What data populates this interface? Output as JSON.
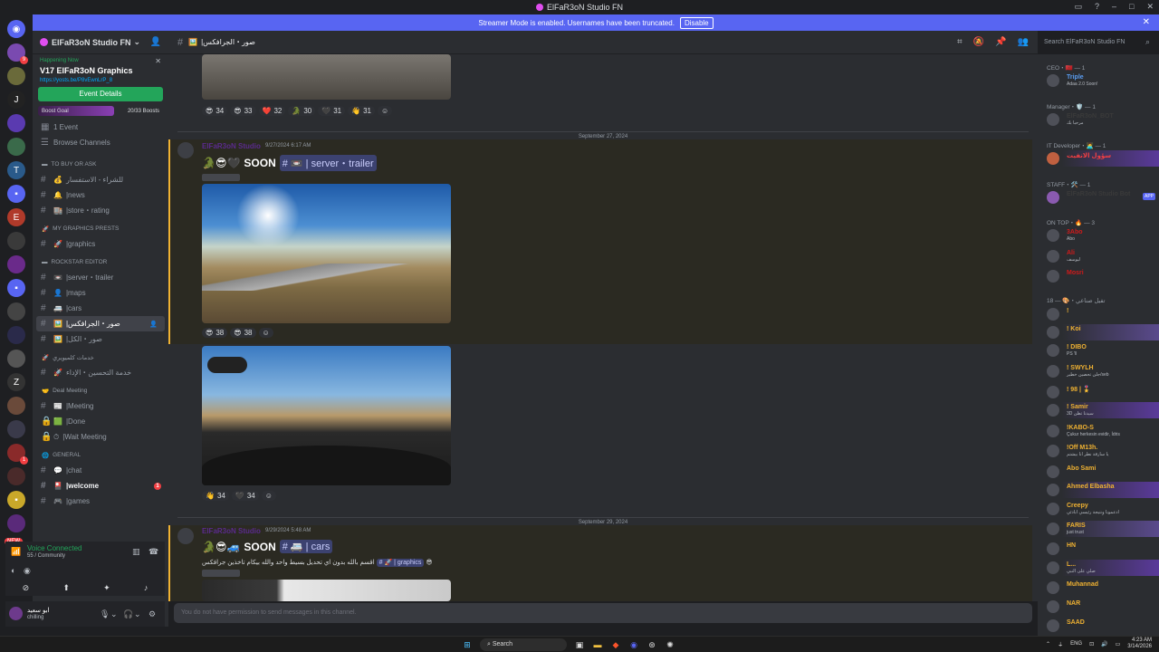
{
  "window": {
    "title": "ElFaR3oN Studio FN"
  },
  "banner": {
    "text": "Streamer Mode is enabled. Usernames have been truncated.",
    "button": "Disable"
  },
  "guild": {
    "name": "ElFaR3oN Studio FN"
  },
  "event": {
    "status": "Happening Now",
    "name": "V17 ElFaR3oN Graphics",
    "link": "https://yosts.be/P8vEwnLrP_8",
    "button": "Event Details"
  },
  "boost": {
    "label": "Boost Goal",
    "progress": "20/33 Boosts",
    "fraction": 0.606
  },
  "sidebar": {
    "events": "1 Event",
    "browse": "Browse Channels",
    "cat1": "TO BUY OR ASK",
    "ch_buy": "للشراء - الاستفسار",
    "ch_news": "news",
    "ch_store": "store・rating",
    "cat2": "MY GRAPHICS PRESTS",
    "ch_graphics": "graphics",
    "cat3": "ROCKSTAR EDITOR",
    "ch_server": "server・trailer",
    "ch_maps": "maps",
    "ch_cars": "cars",
    "ch_active": "صور・الجرافكس",
    "ch_all": "صور・الكل",
    "cat4": "خدمات كلميويري",
    "ch_service": "خدمة التحسين・الإداء",
    "cat5": "Deal Meeting",
    "ch_meeting": "Meeting",
    "ch_done": "Done",
    "ch_wait": "Wait Meeting",
    "cat6": "GENERAL",
    "ch_chat": "chat",
    "ch_welcome": "welcome",
    "ch_games": "games",
    "badge": "1"
  },
  "voice": {
    "status": "Voice Connected",
    "server": "55 / Community"
  },
  "user": {
    "name": "ابو سعيد",
    "status": "chilling"
  },
  "header": {
    "channel": "صور・الجرافكس",
    "search": "Search ElFaR3oN Studio FN"
  },
  "messages": {
    "reacts1": [
      "34",
      "33",
      "32",
      "30",
      "31",
      "31"
    ],
    "date1": "September 27, 2024",
    "author1": "ElFaR3oN Studio",
    "time1": "9/27/2024 6:17 AM",
    "soon1": "SOON",
    "mention1": "# 📼 | server・trailer",
    "reacts2": [
      "38",
      "38"
    ],
    "reacts3": [
      "34",
      "34"
    ],
    "date2": "September 29, 2024",
    "author2": "ElFaR3oN Studio",
    "time2": "9/29/2024 5:48 AM",
    "soon2": "SOON",
    "mention2": "# 🚐 | cars",
    "arabic_line": "اقسم بالله بدون اي تحديل بسيط واحد والله بيكام تاخذين جرافكس",
    "mention3": "# 🚀 | graphics"
  },
  "input": {
    "placeholder": "You do not have permission to send messages in this channel."
  },
  "members": {
    "cat_ceo": "CEO・🇲🇦 — 1",
    "m_triple": "Triple",
    "m_triple_s": "Adaa 2.0 Soon!",
    "cat_mgr": "Manager・🛡️ — 1",
    "m_mgr": "ElFaR3oN_BOT",
    "m_mgr_s": "مرحبا بك",
    "cat_it": "IT Developer・🧑‍💻 — 1",
    "m_it": "سؤول الانفيت",
    "cat_staff": "STAFF・🛠️ — 1",
    "m_staff": "ElFaR3oN Studio Bot",
    "app": "APP",
    "cat_top": "ON TOP・🔥 — 3",
    "m_top1": "3Abo",
    "m_top1_s": "Abo",
    "m_top2": "Ali",
    "m_top2_s": "ليوسف",
    "m_top3": "Mosri",
    "cat_fans": "تفيل صناعي・🎨 — 18",
    "m1": "!",
    "m2": "! Koi",
    "m3": "! DIBO",
    "m3_s": "PS 'll",
    "m4": "! SWYLH",
    "m4_s": "جلن تحصين خطير/seb",
    "m5": "! 98 | 🎖️",
    "m6": "! Samir",
    "m6_s": "3D سيدنا تظن",
    "m7": "!KABO-S",
    "m7_s": "Çukur herkesin evidir, İdris",
    "m8": "!Off M13h.",
    "m8_s": "يا سارقة نطر انا بيشتم",
    "m9": "Abo Sami",
    "m10": "Ahmed Elbasha",
    "m11": "Creepy",
    "m11_s": "ادعمونا ونتيجة رئيسي ابادئي",
    "m12": "FARIS",
    "m12_s": "just trust",
    "m13": "HN",
    "m14": "L...",
    "m14_s": "صلي على النبي",
    "m15": "Muhannad",
    "m16": "NAR",
    "m17": "SAAD"
  },
  "taskbar": {
    "search": "Search",
    "lang": "ENG",
    "time": "4:23 AM",
    "date": "3/14/2026"
  },
  "colors": {
    "accent": "#5865f2",
    "green": "#23a55a",
    "red": "#f23f43",
    "gold": "#f0b232"
  }
}
